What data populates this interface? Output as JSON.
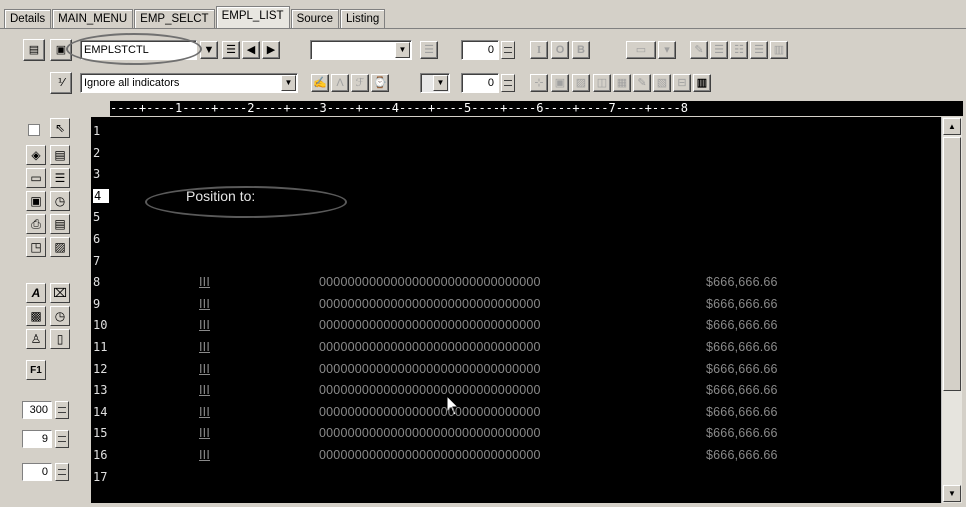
{
  "tabs": [
    "Details",
    "MAIN_MENU",
    "EMP_SELCT",
    "EMPL_LIST",
    "Source",
    "Listing"
  ],
  "active_tab": "EMPL_LIST",
  "toolbar": {
    "record_format": "EMPLSTCTL",
    "indicators": "Ignore all indicators",
    "num_field_1": "0",
    "num_field_2": "0",
    "style_buttons": [
      "I",
      "O",
      "B"
    ]
  },
  "palette": {
    "spin_values": [
      "300",
      "9",
      "0"
    ]
  },
  "ruler": "----+----1----+----2----+----3----+----4----+----5----+----6----+----7----+----8",
  "line_numbers": [
    "1",
    "2",
    "3",
    "4",
    "5",
    "6",
    "7",
    "8",
    "9",
    "10",
    "11",
    "12",
    "13",
    "14",
    "15",
    "16",
    "17"
  ],
  "current_line": "4",
  "screen": {
    "position_label": "Position to:",
    "rows": [
      {
        "ind": "III",
        "id": "0000000000000000000000000000000",
        "amt": "$666,666.66"
      },
      {
        "ind": "III",
        "id": "0000000000000000000000000000000",
        "amt": "$666,666.66"
      },
      {
        "ind": "III",
        "id": "0000000000000000000000000000000",
        "amt": "$666,666.66"
      },
      {
        "ind": "III",
        "id": "0000000000000000000000000000000",
        "amt": "$666,666.66"
      },
      {
        "ind": "III",
        "id": "0000000000000000000000000000000",
        "amt": "$666,666.66"
      },
      {
        "ind": "III",
        "id": "0000000000000000000000000000000",
        "amt": "$666,666.66"
      },
      {
        "ind": "III",
        "id": "0000000000000000000000000000000",
        "amt": "$666,666.66"
      },
      {
        "ind": "III",
        "id": "0000000000000000000000000000000",
        "amt": "$666,666.66"
      },
      {
        "ind": "III",
        "id": "0000000000000000000000000000000",
        "amt": "$666,666.66"
      }
    ]
  }
}
